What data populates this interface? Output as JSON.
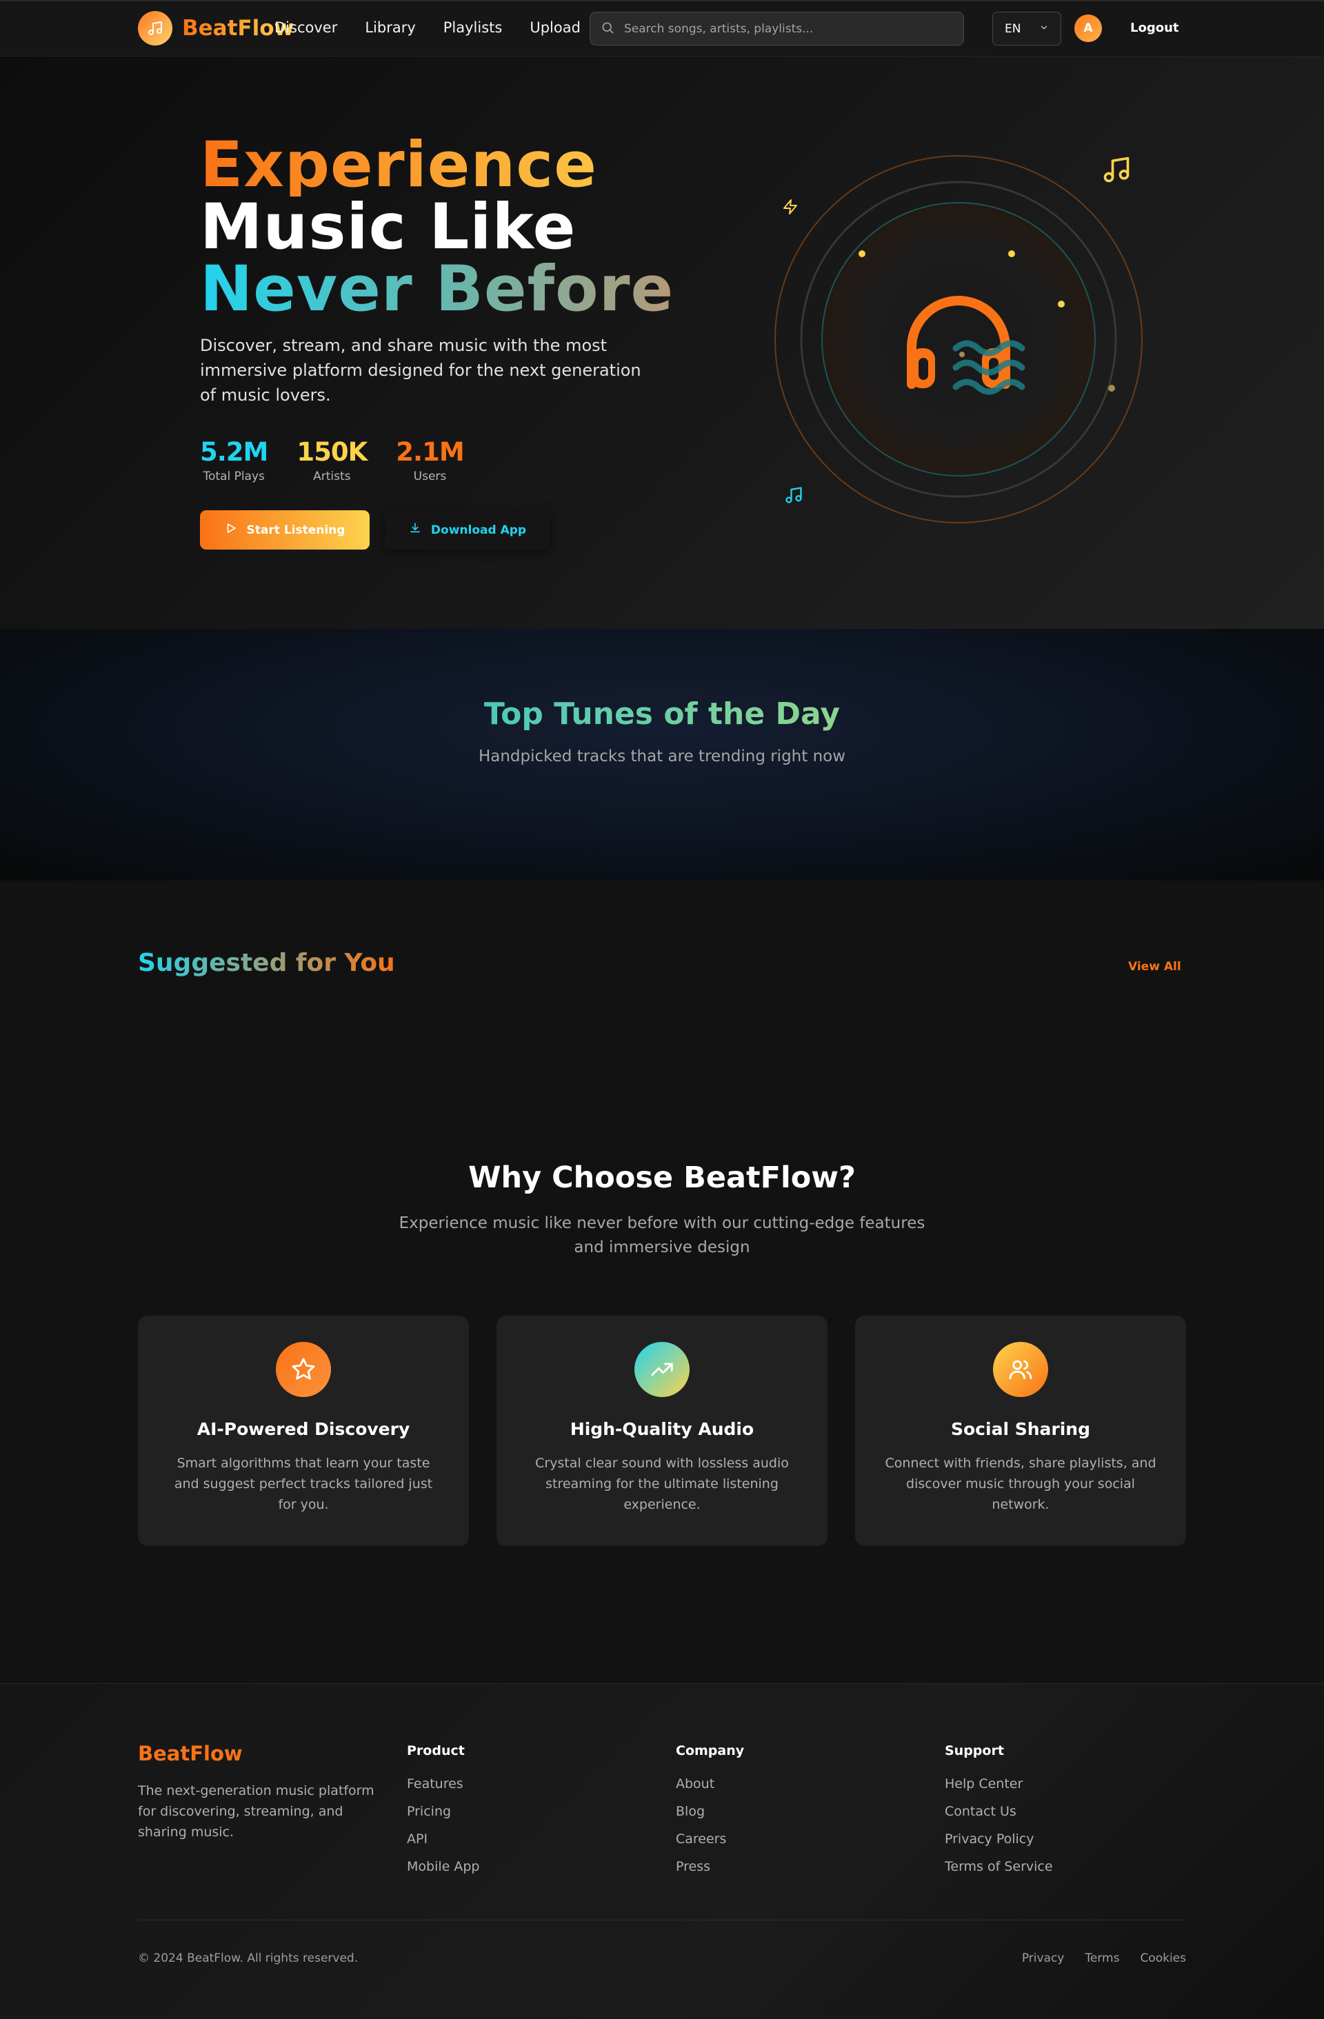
{
  "nav": {
    "brand": "BeatFlow",
    "links": [
      "Discover",
      "Library",
      "Playlists",
      "Upload"
    ],
    "search_placeholder": "Search songs, artists, playlists...",
    "language": "EN",
    "avatar_initial": "A",
    "logout": "Logout"
  },
  "hero": {
    "title_line1": "Experience",
    "title_line2": "Music Like",
    "title_line3": "Never Before",
    "subtitle": "Discover, stream, and share music with the most immersive platform designed for the next generation of music lovers.",
    "stats": [
      {
        "value": "5.2M",
        "label": "Total Plays",
        "color": "#22d3ee"
      },
      {
        "value": "150K",
        "label": "Artists",
        "color": "#fcd34d"
      },
      {
        "value": "2.1M",
        "label": "Users",
        "color": "#f97316"
      }
    ],
    "start_button": "Start Listening",
    "download_button": "Download App",
    "icons": [
      "headphones-icon",
      "music-note-icon",
      "zap-icon"
    ]
  },
  "top_tunes": {
    "title": "Top Tunes of the Day",
    "subtitle": "Handpicked tracks that are trending right now"
  },
  "suggested": {
    "title": "Suggested for You",
    "view_all": "View All"
  },
  "why": {
    "title": "Why Choose BeatFlow?",
    "subtitle": "Experience music like never before with our cutting-edge features and immersive design",
    "cards": [
      {
        "title": "AI-Powered Discovery",
        "desc": "Smart algorithms that learn your taste and suggest perfect tracks tailored just for you.",
        "icon": "star-icon"
      },
      {
        "title": "High-Quality Audio",
        "desc": "Crystal clear sound with lossless audio streaming for the ultimate listening experience.",
        "icon": "trending-up-icon"
      },
      {
        "title": "Social Sharing",
        "desc": "Connect with friends, share playlists, and discover music through your social network.",
        "icon": "users-icon"
      }
    ]
  },
  "footer": {
    "brand": "BeatFlow",
    "description": "The next-generation music platform for discovering, streaming, and sharing music.",
    "columns": [
      {
        "title": "Product",
        "links": [
          "Features",
          "Pricing",
          "API",
          "Mobile App"
        ]
      },
      {
        "title": "Company",
        "links": [
          "About",
          "Blog",
          "Careers",
          "Press"
        ]
      },
      {
        "title": "Support",
        "links": [
          "Help Center",
          "Contact Us",
          "Privacy Policy",
          "Terms of Service"
        ]
      }
    ],
    "copyright": "© 2024 BeatFlow. All rights reserved.",
    "legal": [
      "Privacy",
      "Terms",
      "Cookies"
    ]
  },
  "colors": {
    "orange": "#f97316",
    "yellow": "#fcd34d",
    "cyan": "#22d3ee",
    "background": "#121212"
  }
}
